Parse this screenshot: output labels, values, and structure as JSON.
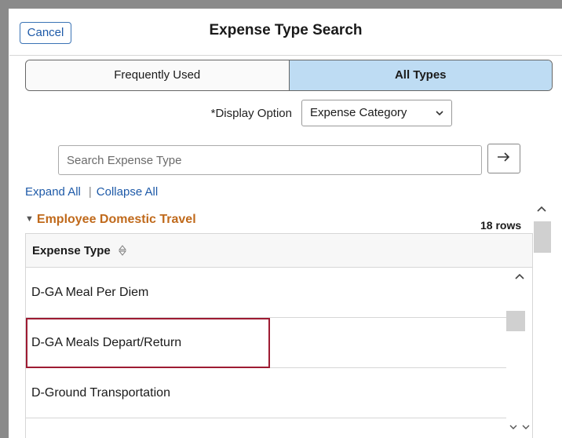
{
  "header": {
    "cancel_label": "Cancel",
    "title": "Expense Type Search"
  },
  "tabs": [
    {
      "label": "Frequently Used",
      "active": false
    },
    {
      "label": "All Types",
      "active": true
    }
  ],
  "display_option": {
    "label": "*Display Option",
    "selected": "Expense Category"
  },
  "search": {
    "placeholder": "Search Expense Type",
    "value": ""
  },
  "links": {
    "expand_all": "Expand All",
    "separator": "|",
    "collapse_all": "Collapse All"
  },
  "group": {
    "title": "Employee Domestic Travel",
    "rows_count": "18 rows"
  },
  "grid": {
    "column_header": "Expense Type",
    "rows": [
      {
        "label": "D-GA Meal Per Diem"
      },
      {
        "label": "D-GA Meals Depart/Return"
      },
      {
        "label": "D-Ground Transportation"
      }
    ]
  },
  "colors": {
    "accent": "#1e5aa8",
    "active_tab": "#bedcf3",
    "group_title": "#c06a1c",
    "highlight_border": "#9e1b32"
  },
  "icons": {
    "go": "arrow-right-icon",
    "dropdown": "chevron-down-icon",
    "collapse": "triangle-down-icon",
    "sort": "sort-icon"
  }
}
